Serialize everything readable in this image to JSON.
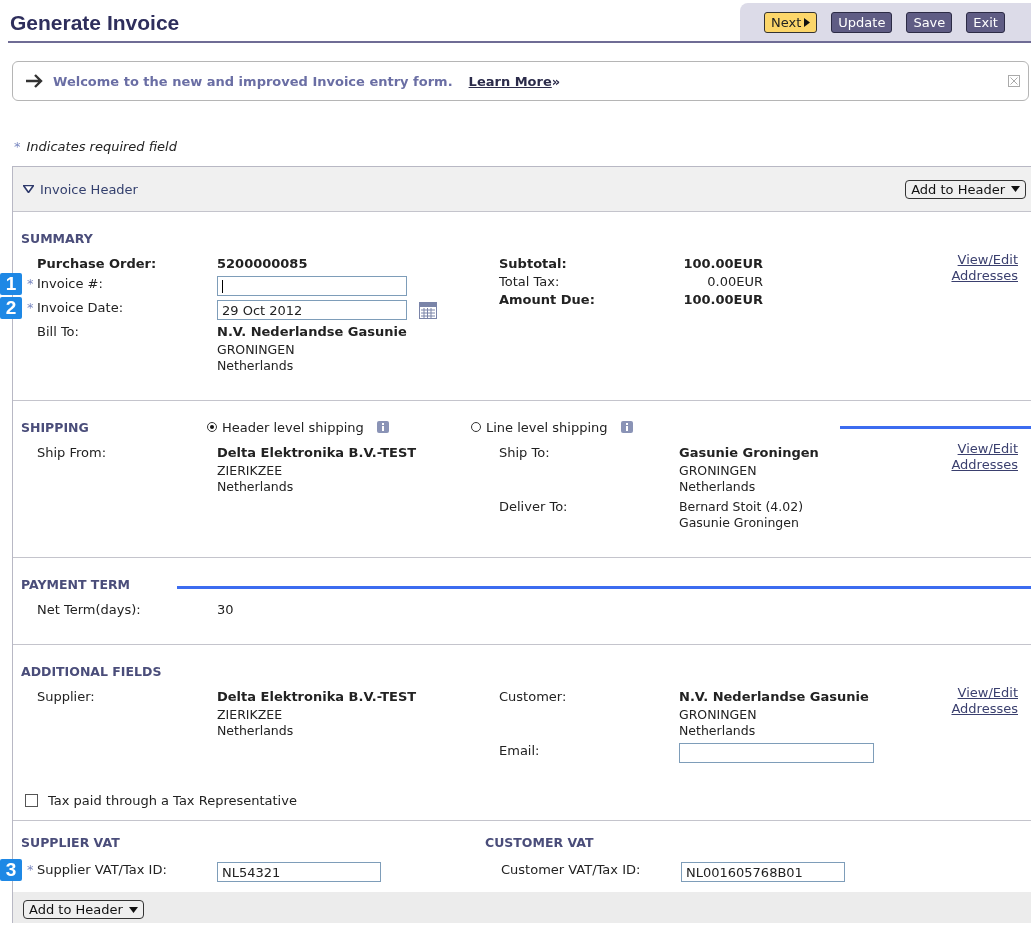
{
  "title": "Generate Invoice",
  "toolbar": [
    {
      "label": "Next",
      "kind": "primary"
    },
    {
      "label": "Update",
      "kind": "secondary"
    },
    {
      "label": "Save",
      "kind": "secondary"
    },
    {
      "label": "Exit",
      "kind": "secondary"
    }
  ],
  "banner": {
    "text": "Welcome to the new and improved Invoice entry form.",
    "link": "Learn More",
    "link_suffix": "»"
  },
  "required_note": {
    "mark": "*",
    "text": "Indicates required field"
  },
  "panel": {
    "title": "Invoice Header",
    "expanded": true,
    "add_button": "Add to Header",
    "footer_button": "Add to Header"
  },
  "summary": {
    "heading": "SUMMARY",
    "link": [
      "View/Edit",
      "Addresses"
    ],
    "left": [
      {
        "kind": "text",
        "label": "Purchase Order:",
        "value": "5200000085",
        "bold": true
      },
      {
        "kind": "input",
        "label": "Invoice #:",
        "required": true,
        "callout": "1"
      },
      {
        "kind": "date",
        "label": "Invoice Date:",
        "value": "29 Oct 2012",
        "required": true,
        "callout": "2"
      },
      {
        "kind": "address",
        "label": "Bill To:",
        "name": "N.V. Nederlandse Gasunie",
        "lines": [
          "GRONINGEN",
          "Netherlands"
        ]
      }
    ],
    "right": [
      {
        "kind": "amount",
        "label": "Subtotal:",
        "value": "100.00EUR",
        "bold": true
      },
      {
        "kind": "amount",
        "label": "Total Tax:",
        "value": "0.00EUR",
        "bold": false
      },
      {
        "kind": "amount",
        "label": "Amount Due:",
        "value": "100.00EUR",
        "bold": true
      }
    ]
  },
  "shipping": {
    "heading": "SHIPPING",
    "options": [
      {
        "label": "Header level shipping",
        "selected": true
      },
      {
        "label": "Line level shipping",
        "selected": false
      }
    ],
    "link": [
      "View/Edit",
      "Addresses"
    ],
    "left": [
      {
        "kind": "address",
        "label": "Ship From:",
        "name": "Delta Elektronika B.V.-TEST",
        "lines": [
          "ZIERIKZEE",
          "Netherlands"
        ]
      }
    ],
    "right": [
      {
        "kind": "address",
        "label": "Ship To:",
        "name": "Gasunie Groningen",
        "lines": [
          "GRONINGEN",
          "Netherlands"
        ]
      },
      {
        "kind": "lines",
        "label": "Deliver To:",
        "lines": [
          "Bernard Stoit (4.02)",
          "Gasunie Groningen"
        ]
      }
    ]
  },
  "payment": {
    "heading": "PAYMENT TERM",
    "left": [
      {
        "kind": "text",
        "label": "Net Term(days):",
        "value": "30",
        "bold": false
      }
    ]
  },
  "additional": {
    "heading": "ADDITIONAL FIELDS",
    "link": [
      "View/Edit",
      "Addresses"
    ],
    "left": [
      {
        "kind": "address",
        "label": "Supplier:",
        "name": "Delta Elektronika B.V.-TEST",
        "lines": [
          "ZIERIKZEE",
          "Netherlands"
        ]
      }
    ],
    "right": [
      {
        "kind": "address",
        "label": "Customer:",
        "name": "N.V. Nederlandse Gasunie",
        "lines": [
          "GRONINGEN",
          "Netherlands"
        ]
      },
      {
        "kind": "input",
        "label": "Email:"
      }
    ],
    "checkbox": {
      "label": "Tax paid through a Tax Representative",
      "checked": false
    }
  },
  "vat": {
    "supplier_heading": "SUPPLIER VAT",
    "customer_heading": "CUSTOMER VAT",
    "supplier": {
      "label": "Supplier VAT/Tax ID:",
      "value": "NL54321",
      "required": true,
      "callout": "3"
    },
    "customer": {
      "label": "Customer VAT/Tax ID:",
      "value": "NL001605768B01"
    }
  }
}
